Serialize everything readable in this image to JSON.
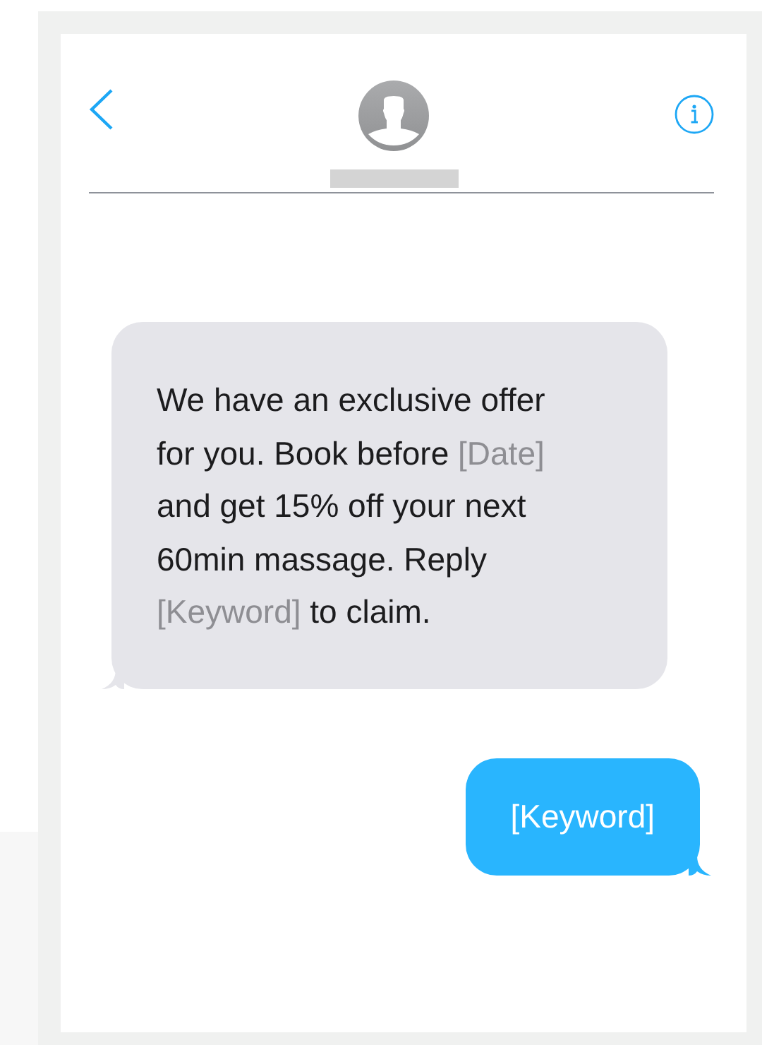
{
  "messages": [
    {
      "kind": "incoming",
      "segments": [
        {
          "kind": "plain",
          "text": "We have an exclusive offer for you. Book before "
        },
        {
          "kind": "placeholder",
          "text": "[Date]"
        },
        {
          "kind": "plain",
          "text": " and get 15% off your next 60min massage. Reply "
        },
        {
          "kind": "placeholder",
          "text": "[Keyword]"
        },
        {
          "kind": "plain",
          "text": " to claim."
        }
      ]
    },
    {
      "kind": "outgoing",
      "segments": [
        {
          "kind": "plain",
          "text": "[Keyword]"
        }
      ]
    }
  ]
}
